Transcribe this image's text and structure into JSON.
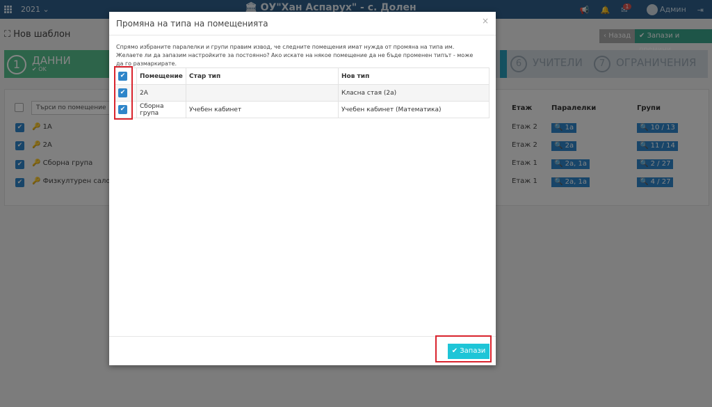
{
  "topbar": {
    "year": "2021 ⌄",
    "school": "ОУ\"Хан Аспарух\" - с. Долен",
    "notifications_badge": "1",
    "user": "Админ"
  },
  "page": {
    "title": "Нов шаблон",
    "back_label": "Назад",
    "save_next_label": "Запази и премини"
  },
  "steps": [
    {
      "num": "1",
      "label": "ДАННИ",
      "status": "OK"
    },
    {
      "num": "6",
      "label": "УЧИТЕЛИ"
    },
    {
      "num": "7",
      "label": "ОГРАНИЧЕНИЯ"
    }
  ],
  "background_table": {
    "search_placeholder": "Търси по помещение",
    "headers": {
      "floor": "Етаж",
      "parallels": "Паралелки",
      "groups": "Групи"
    },
    "rows": [
      {
        "name": "1А",
        "floor": "Етаж 2",
        "parallels": "1а",
        "groups": "10 / 13"
      },
      {
        "name": "2А",
        "floor": "Етаж 2",
        "parallels": "2а",
        "groups": "11 / 14"
      },
      {
        "name": "Сборна група",
        "floor": "Етаж 1",
        "parallels": "2а, 1а",
        "groups": "2 / 27"
      },
      {
        "name": "Физкултурен салон",
        "floor": "Етаж 1",
        "parallels": "2а, 1а",
        "groups": "4 / 27"
      }
    ]
  },
  "modal": {
    "title": "Промяна на типа на помещенията",
    "close": "×",
    "description": "Спрямо избраните паралелки и групи правим извод, че следните помещения имат нужда от промяна на типа им. Желаете ли да запазим настройките за постоянно? Ако искате на някое помещение да не бъде променен типът - може да го размаркирате.",
    "headers": {
      "room": "Помещение",
      "old_type": "Стар тип",
      "new_type": "Нов тип"
    },
    "rows": [
      {
        "room": "2А",
        "old_type": "",
        "new_type": "Класна стая (2а)"
      },
      {
        "room": "Сборна група",
        "old_type": "Учебен кабинет",
        "new_type": "Учебен кабинет (Математика)"
      }
    ],
    "save_label": "Запази"
  },
  "colors": {
    "topbar": "#2f5f8a",
    "step_done": "#56c08f",
    "primary": "#2e85c9",
    "save": "#1ec5d7",
    "highlight": "#d9232d"
  }
}
